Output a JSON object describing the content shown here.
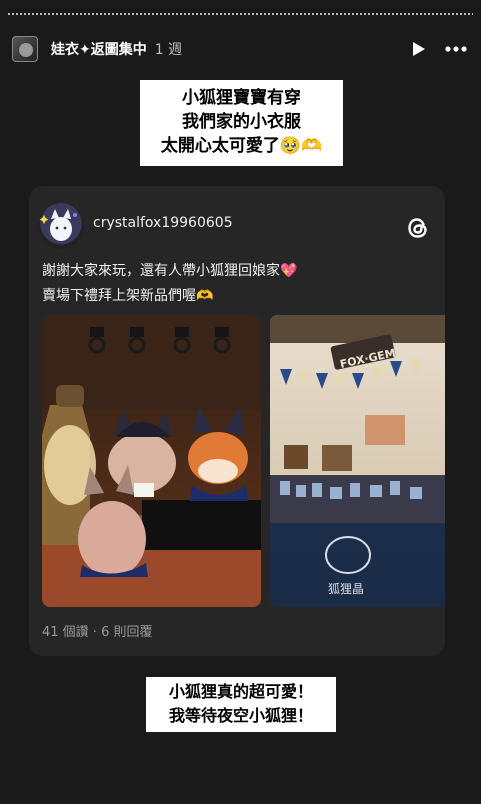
{
  "story": {
    "username": "娃衣✦返圖集中",
    "time": "1 週",
    "icons": {
      "play": "play-icon",
      "more": "more-icon"
    }
  },
  "sticker_top": {
    "lines": [
      "小狐狸寶寶有穿",
      "我們家的小衣服",
      "太開心太可愛了🥹🫶"
    ]
  },
  "post": {
    "username": "crystalfox19960605",
    "icon": "threads-icon",
    "text_lines": [
      "謝謝大家來玩，還有人帶小狐狸回娘家💖",
      "賣場下禮拜上架新品們喔🫶"
    ],
    "stats": "41 個讚 · 6 則回覆",
    "photos": [
      {
        "name": "fox-plush-photo"
      },
      {
        "name": "booth-photo",
        "sign": "FOX·GEM",
        "banner": "狐狸晶"
      }
    ]
  },
  "sticker_bottom": {
    "lines": [
      "小狐狸真的超可愛！",
      "我等待夜空小狐狸！"
    ]
  },
  "colors": {
    "background": "#1a1a1a",
    "card": "#262626",
    "sticker": "#ffffff"
  }
}
